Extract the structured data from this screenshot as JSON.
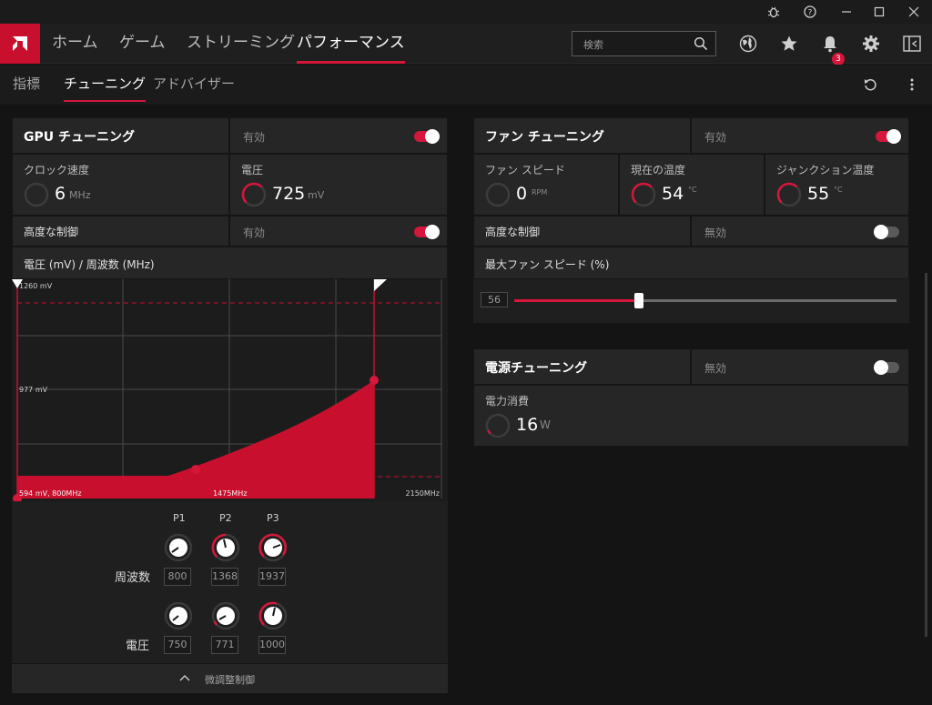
{
  "nav": {
    "items": [
      {
        "label": "ホーム"
      },
      {
        "label": "ゲーム"
      },
      {
        "label": "ストリーミング"
      },
      {
        "label": "パフォーマンス"
      }
    ],
    "search_placeholder": "検索",
    "notification_count": "3"
  },
  "subnav": {
    "items": [
      {
        "label": "指標"
      },
      {
        "label": "チューニング"
      },
      {
        "label": "アドバイザー"
      }
    ]
  },
  "gpu": {
    "title": "GPU チューニング",
    "state": "有効",
    "clock_label": "クロック速度",
    "clock_value": "6",
    "clock_unit": "MHz",
    "voltage_label": "電圧",
    "voltage_value": "725",
    "voltage_unit": "mV",
    "advanced_label": "高度な制御",
    "advanced_state": "有効",
    "curve_title": "電圧 (mV) / 周波数 (MHz)",
    "chart_labels": {
      "max_v": "1260 mV",
      "mid_v": "977 mV",
      "origin": "594 mV, 800MHz",
      "mid_f": "1475MHz",
      "max_f": "2150MHz"
    },
    "p_labels": [
      "P1",
      "P2",
      "P3"
    ],
    "freq_label": "周波数",
    "freq_values": [
      "800",
      "1368",
      "1937"
    ],
    "volt_label": "電圧",
    "volt_values": [
      "750",
      "771",
      "1000"
    ],
    "fine_control": "微調整制御"
  },
  "fan": {
    "title": "ファン チューニング",
    "state": "有効",
    "speed_label": "ファン スピード",
    "speed_value": "0",
    "speed_unit": "RPM",
    "temp_label": "現在の温度",
    "temp_value": "54",
    "temp_unit": "°C",
    "junction_label": "ジャンクション温度",
    "junction_value": "55",
    "junction_unit": "°C",
    "advanced_label": "高度な制御",
    "advanced_state": "無効",
    "max_speed_label": "最大ファン スピード (%)",
    "max_speed_value": "56"
  },
  "power": {
    "title": "電源チューニング",
    "state": "無効",
    "consumption_label": "電力消費",
    "consumption_value": "16",
    "consumption_unit": "W"
  },
  "colors": {
    "accent": "#d6163b",
    "panel": "#262626",
    "background": "#141414"
  }
}
